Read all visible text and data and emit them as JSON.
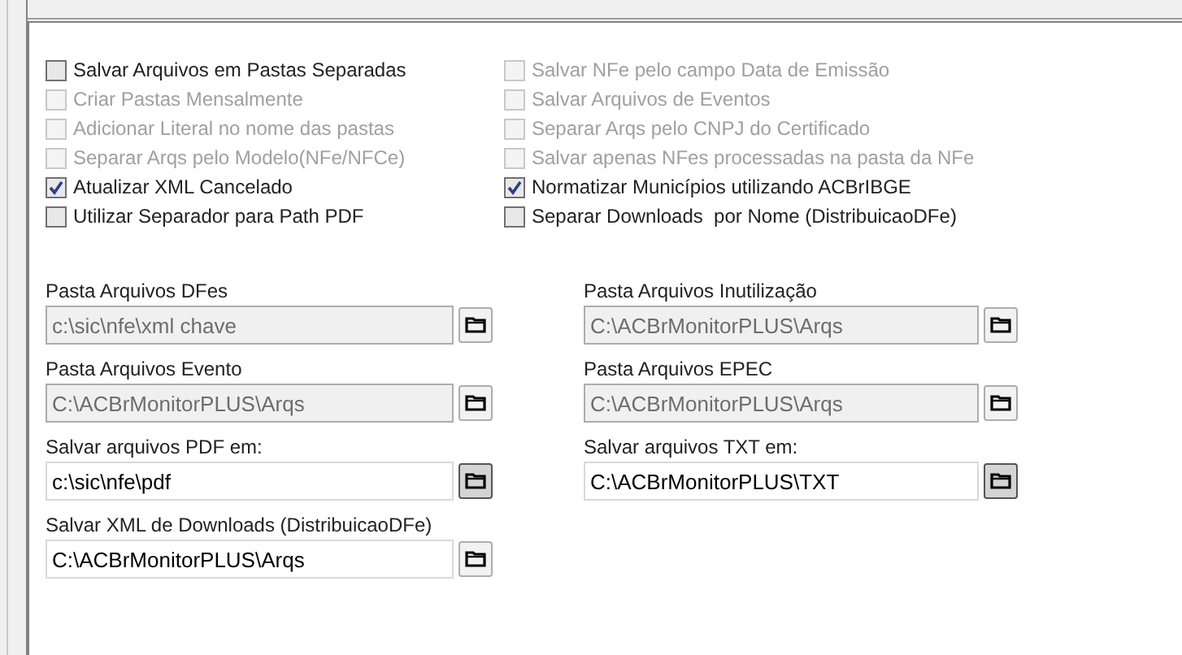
{
  "options_left": [
    {
      "label": "Salvar Arquivos em Pastas Separadas",
      "checked": false,
      "disabled": false
    },
    {
      "label": "Criar Pastas Mensalmente",
      "checked": false,
      "disabled": true
    },
    {
      "label": "Adicionar Literal no nome das pastas",
      "checked": false,
      "disabled": true
    },
    {
      "label": "Separar Arqs pelo Modelo(NFe/NFCe)",
      "checked": false,
      "disabled": true
    },
    {
      "label": "Atualizar XML Cancelado",
      "checked": true,
      "disabled": false
    },
    {
      "label": "Utilizar Separador para Path PDF",
      "checked": false,
      "disabled": false
    }
  ],
  "options_right": [
    {
      "label": "Salvar NFe pelo campo Data de Emissão",
      "checked": false,
      "disabled": true
    },
    {
      "label": "Salvar Arquivos de Eventos",
      "checked": false,
      "disabled": true
    },
    {
      "label": "Separar Arqs pelo CNPJ do Certificado",
      "checked": false,
      "disabled": true
    },
    {
      "label": "Salvar apenas NFes processadas na pasta da NFe",
      "checked": false,
      "disabled": true
    },
    {
      "label": "Normatizar Municípios utilizando ACBrIBGE",
      "checked": true,
      "disabled": false
    },
    {
      "label": "Separar Downloads  por Nome (DistribuicaoDFe)",
      "checked": false,
      "disabled": false
    }
  ],
  "paths_left": [
    {
      "label": "Pasta Arquivos DFes",
      "value": "c:\\sic\\nfe\\xml chave",
      "disabled": true,
      "pressed": false
    },
    {
      "label": "Pasta Arquivos Evento",
      "value": "C:\\ACBrMonitorPLUS\\Arqs",
      "disabled": true,
      "pressed": false
    },
    {
      "label": "Salvar arquivos PDF em:",
      "value": "c:\\sic\\nfe\\pdf",
      "disabled": false,
      "pressed": true
    },
    {
      "label": "Salvar XML de Downloads (DistribuicaoDFe)",
      "value": "C:\\ACBrMonitorPLUS\\Arqs",
      "disabled": false,
      "pressed": false
    }
  ],
  "paths_right": [
    {
      "label": "Pasta Arquivos Inutilização",
      "value": "C:\\ACBrMonitorPLUS\\Arqs",
      "disabled": true,
      "pressed": false
    },
    {
      "label": "Pasta Arquivos EPEC",
      "value": "C:\\ACBrMonitorPLUS\\Arqs",
      "disabled": true,
      "pressed": false
    },
    {
      "label": "Salvar arquivos TXT em:",
      "value": "C:\\ACBrMonitorPLUS\\TXT",
      "disabled": false,
      "pressed": true
    }
  ]
}
